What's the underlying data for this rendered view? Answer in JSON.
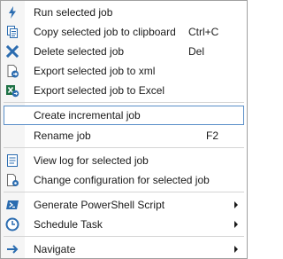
{
  "menu": {
    "items": [
      {
        "label": "Run selected job",
        "icon": "lightning-icon"
      },
      {
        "label": "Copy selected job to clipboard",
        "shortcut": "Ctrl+C",
        "icon": "copy-icon"
      },
      {
        "label": "Delete selected job",
        "shortcut": "Del",
        "icon": "delete-x-icon"
      },
      {
        "label": "Export selected job to xml",
        "icon": "export-xml-icon"
      },
      {
        "label": "Export selected job to Excel",
        "icon": "excel-icon"
      },
      {
        "label": "Create incremental job",
        "highlighted": true
      },
      {
        "label": "Rename job",
        "shortcut": "F2"
      },
      {
        "label": "View log for selected job",
        "icon": "log-icon"
      },
      {
        "label": "Change configuration for selected job",
        "icon": "config-icon"
      },
      {
        "label": "Generate PowerShell Script",
        "icon": "powershell-icon",
        "submenu": true
      },
      {
        "label": "Schedule Task",
        "icon": "clock-icon",
        "submenu": true
      },
      {
        "label": "Navigate",
        "icon": "arrow-right-icon",
        "submenu": true
      }
    ]
  },
  "colors": {
    "icon_blue": "#2b6cb0",
    "highlight_border": "#5a8fc8",
    "excel_green": "#1e7145"
  }
}
